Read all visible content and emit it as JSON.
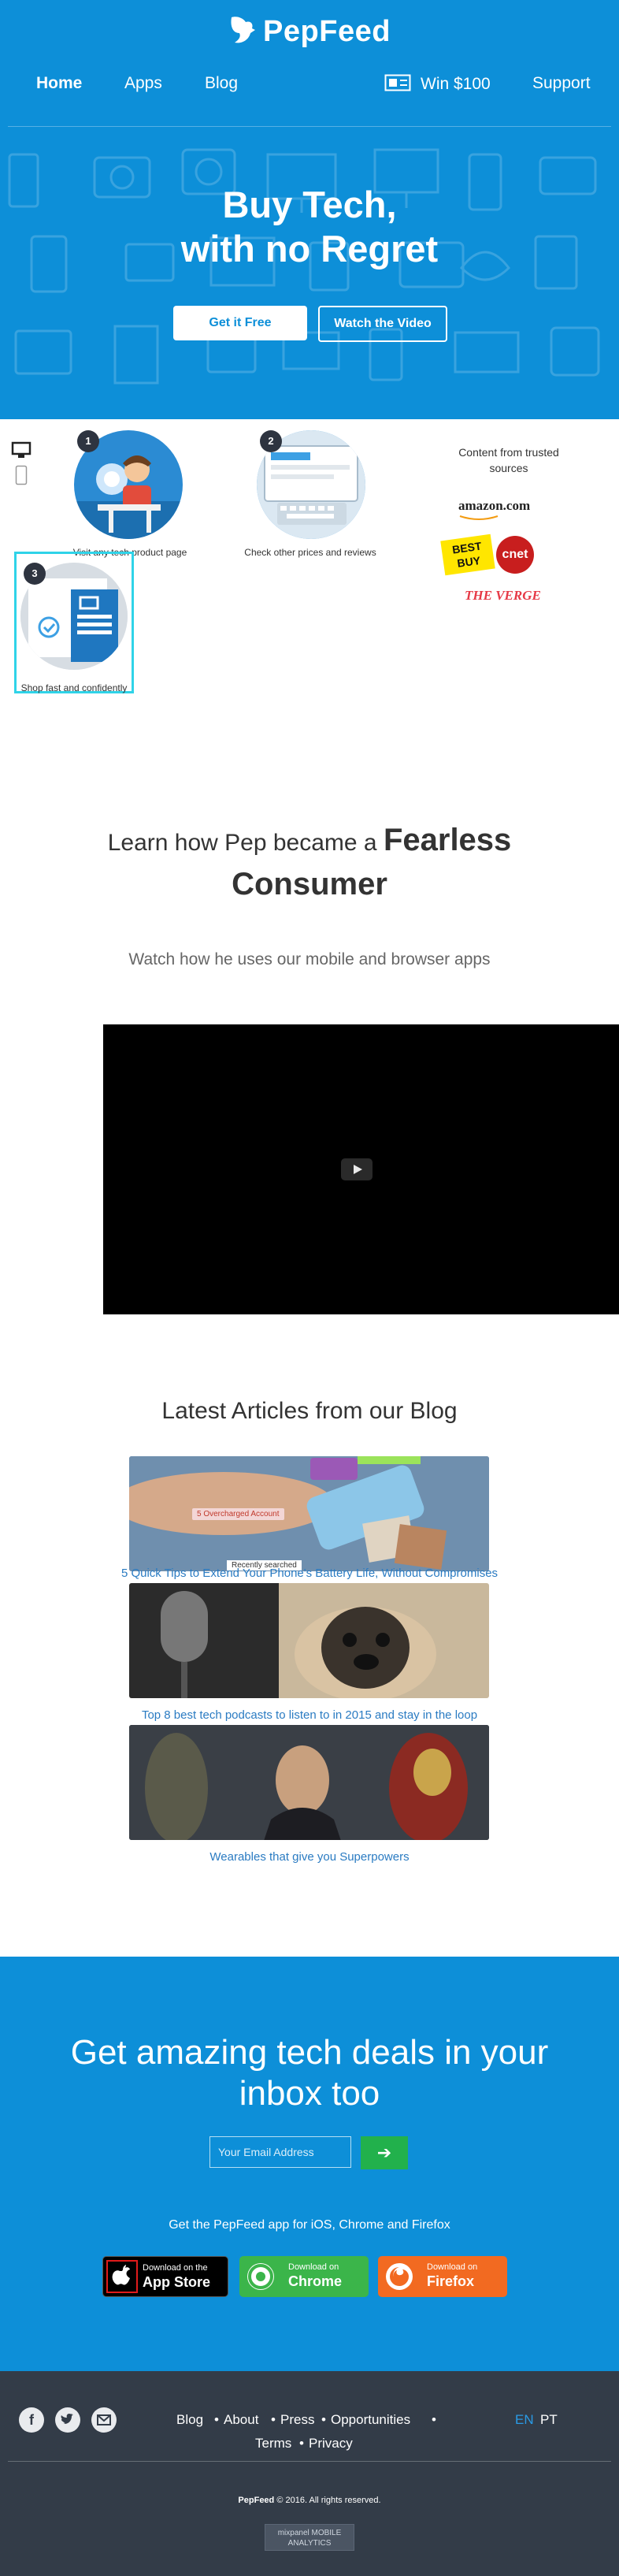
{
  "header": {
    "logo_text": "PepFeed",
    "nav": {
      "home": "Home",
      "apps": "Apps",
      "blog": "Blog",
      "win": "Win $100",
      "support": "Support"
    }
  },
  "hero": {
    "title_line1": "Buy Tech,",
    "title_line2": "with no Regret",
    "cta_primary": "Get it Free",
    "cta_secondary": "Watch the Video"
  },
  "steps": [
    {
      "number": "1",
      "caption": "Visit any tech product page"
    },
    {
      "number": "2",
      "caption": "Check other prices and reviews"
    },
    {
      "number": "3",
      "caption": "Shop fast and confidently"
    }
  ],
  "sources": {
    "title": "Content from trusted sources",
    "logos": [
      "amazon.com",
      "BEST BUY",
      "cnet",
      "THE VERGE"
    ]
  },
  "learn": {
    "prefix": "Learn how Pep became a",
    "emphasis_1": "Fearless",
    "emphasis_2": "Consumer",
    "subtitle": "Watch how he uses our mobile and browser apps"
  },
  "blog": {
    "title": "Latest Articles from our Blog",
    "articles": [
      {
        "title": "5 Quick Tips to Extend Your Phone's Battery Life, Without Compromises",
        "thumb_tags": [
          "5 Overcharged Account",
          "Recently searched"
        ]
      },
      {
        "title": "Top 8 best tech podcasts to listen to in 2015 and stay in the loop"
      },
      {
        "title": "Wearables that give you Superpowers"
      }
    ]
  },
  "newsletter": {
    "title_line1": "Get amazing tech deals in your",
    "title_line2": "inbox too",
    "email_placeholder": "Your Email Address",
    "submit_glyph": "➔",
    "apps_text": "Get the PepFeed app for iOS, Chrome and Firefox",
    "stores": [
      {
        "small": "Download on the",
        "big": "App Store"
      },
      {
        "small": "Download on",
        "big": "Chrome"
      },
      {
        "small": "Download on",
        "big": "Firefox"
      }
    ]
  },
  "footer": {
    "links": [
      "Blog",
      "About",
      "Press",
      "Opportunities",
      "Terms",
      "Privacy"
    ],
    "separator": "•",
    "languages": [
      "EN",
      "PT"
    ],
    "copyright_brand": "PepFeed",
    "copyright_rest": "© 2016. All rights reserved.",
    "badge_line1": "mixpanel MOBILE",
    "badge_line2": "ANALYTICS"
  },
  "colors": {
    "brand_blue": "#0d8fd8",
    "footer_dark": "#333c48",
    "success_green": "#22b14c",
    "link_blue": "#2a7bc2"
  }
}
